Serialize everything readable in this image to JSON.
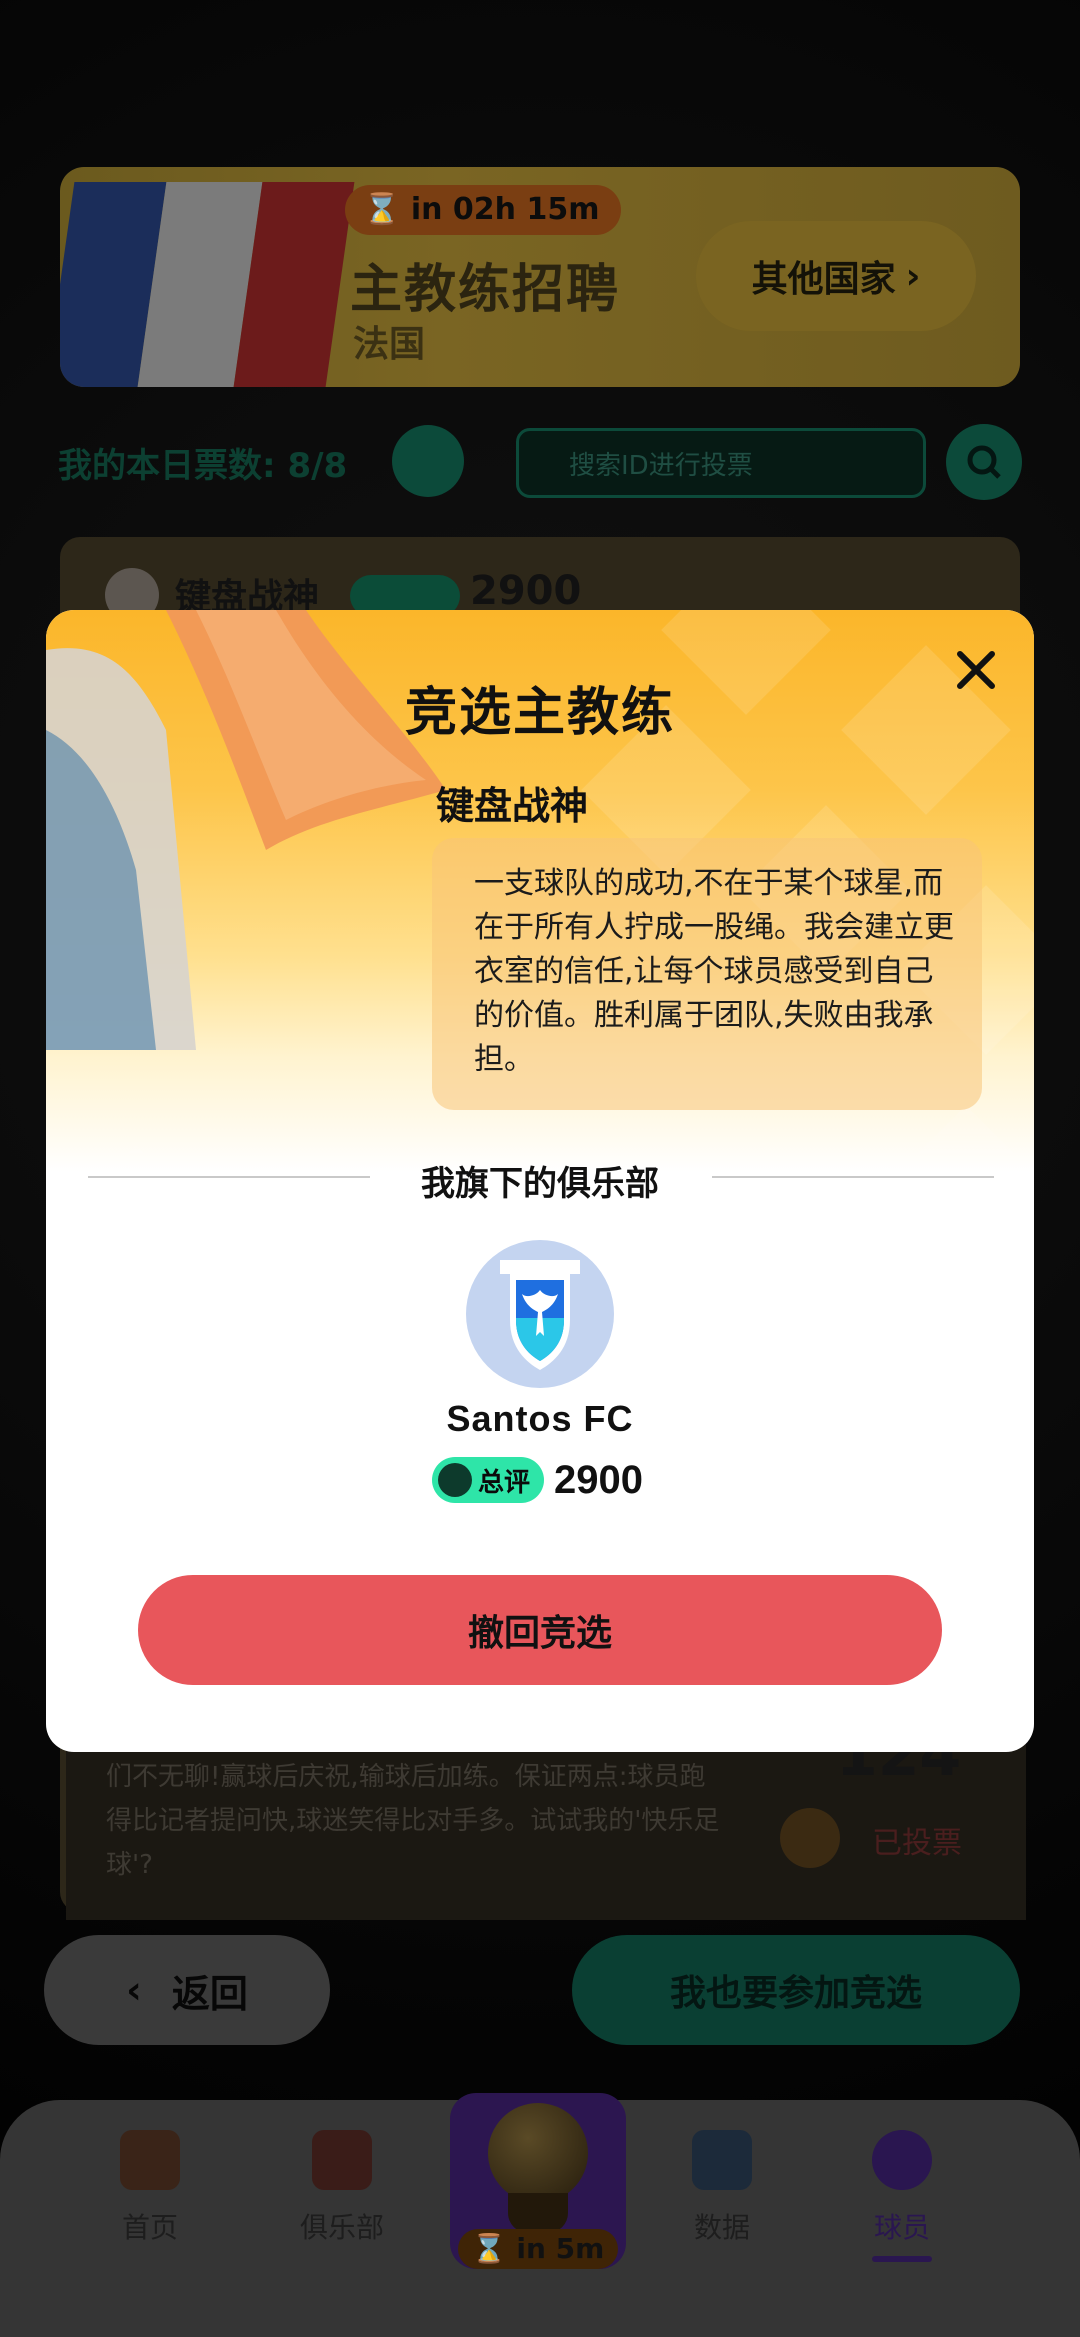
{
  "banner": {
    "timer": "in 02h 15m",
    "title": "主教练招聘",
    "subtitle": "法国",
    "other_button": "其他国家"
  },
  "votes": {
    "label": "我的本日票数:",
    "value": "8/8",
    "search_placeholder": "搜索ID进行投票"
  },
  "background_card": {
    "name": "键盘战神",
    "rating_label": "总评",
    "score": "2900",
    "text": "们不无聊!赢球后庆祝,输球后加练。保证两点:球员跑得比记者提问快,球迷笑得比对手多。试试我的'快乐足球'?",
    "vote_count": "124",
    "voted_label": "已投票"
  },
  "footer_buttons": {
    "back": "返回",
    "join": "我也要参加竞选"
  },
  "tabbar": {
    "items": [
      {
        "label": "首页",
        "icon": "home-icon"
      },
      {
        "label": "俱乐部",
        "icon": "club-icon"
      },
      {
        "label": "数据",
        "icon": "chart-icon"
      },
      {
        "label": "球员",
        "icon": "player-icon"
      }
    ],
    "center_timer": "in 5m",
    "active": "球员"
  },
  "modal": {
    "title": "竞选主教练",
    "coach_name": "键盘战神",
    "quote": "一支球队的成功,不在于某个球星,而在于所有人拧成一股绳。我会建立更衣室的信任,让每个球员感受到自己的价值。胜利属于团队,失败由我承担。",
    "section_title": "我旗下的俱乐部",
    "club_name": "Santos FC",
    "rating_label": "总评",
    "rating_score": "2900",
    "withdraw_button": "撤回竞选"
  },
  "colors": {
    "accent_green": "#2ee5a8",
    "withdraw_red": "#e8565b",
    "modal_gold": "#fbb62a",
    "active_tab": "#7b3fe4"
  }
}
